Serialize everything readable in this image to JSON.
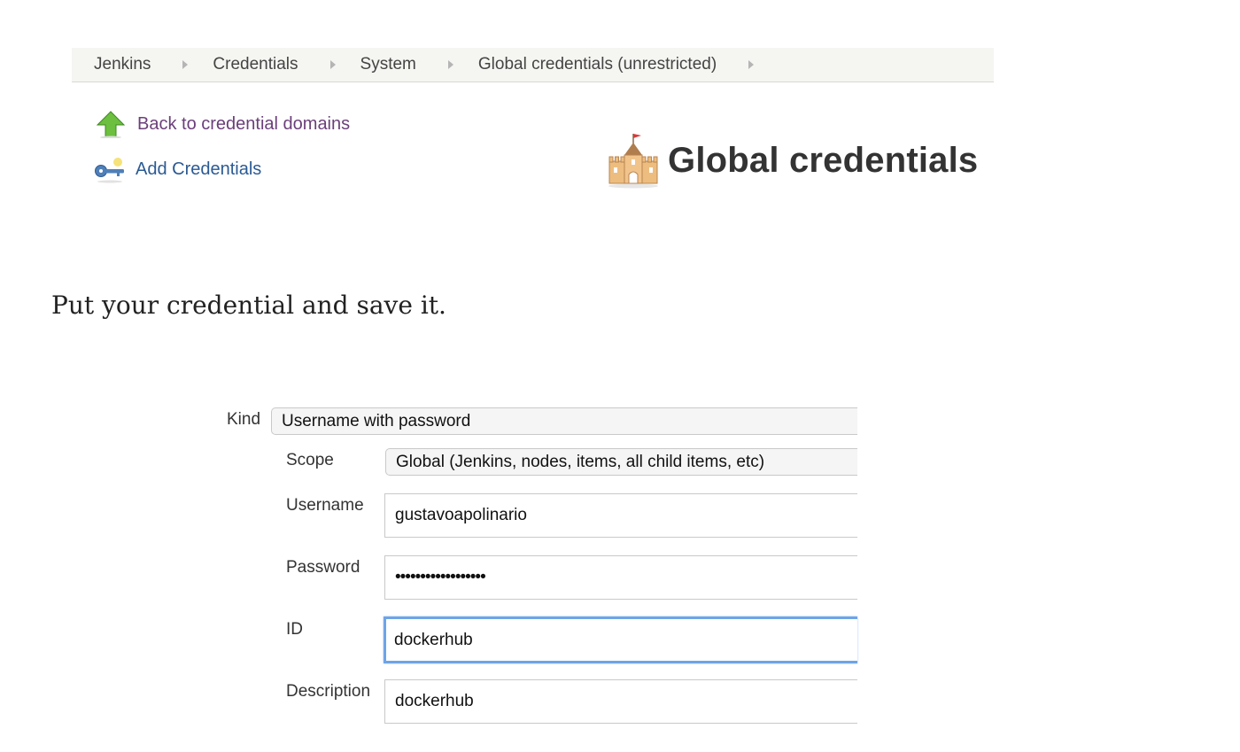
{
  "breadcrumb": {
    "items": [
      "Jenkins",
      "Credentials",
      "System",
      "Global credentials (unrestricted)"
    ]
  },
  "sidebar": {
    "back_label": "Back to credential domains",
    "add_label": "Add Credentials"
  },
  "page": {
    "title": "Global credentials"
  },
  "article": {
    "instruction": "Put your credential and save it."
  },
  "form": {
    "kind_label": "Kind",
    "kind_value": "Username with password",
    "scope_label": "Scope",
    "scope_value": "Global (Jenkins, nodes, items, all child items, etc)",
    "username_label": "Username",
    "username_value": "gustavoapolinario",
    "password_label": "Password",
    "password_value": "••••••••••••••••••",
    "id_label": "ID",
    "id_value": "dockerhub",
    "description_label": "Description",
    "description_value": "dockerhub"
  },
  "colors": {
    "breadcrumb_bg": "#f5f6f2",
    "visited_link": "#6b3f7a",
    "link": "#2b5a93",
    "focus_ring": "#6ea4e8"
  }
}
